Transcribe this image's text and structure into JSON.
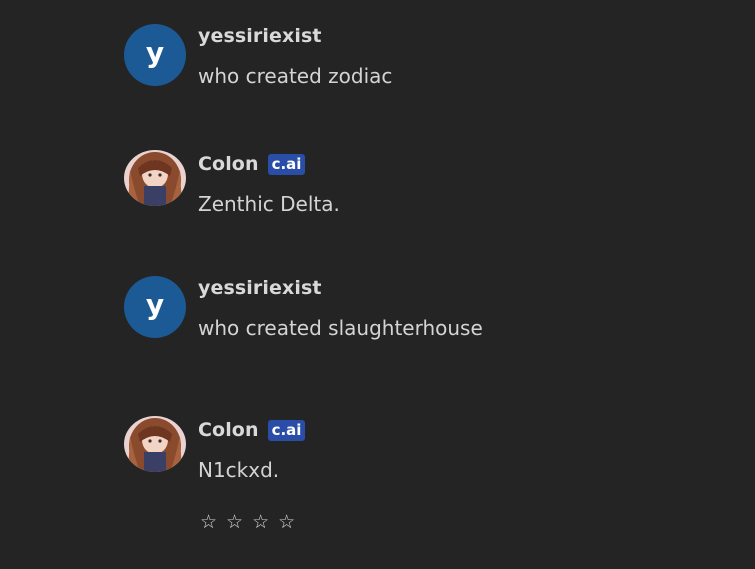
{
  "messages": [
    {
      "author": "yessiriexist",
      "avatar_letter": "y",
      "text": "who created zodiac"
    },
    {
      "author": "Colon",
      "badge": "c.ai",
      "text": "Zenthic Delta."
    },
    {
      "author": "yessiriexist",
      "avatar_letter": "y",
      "text": "who created slaughterhouse"
    },
    {
      "author": "Colon",
      "badge": "c.ai",
      "text": "N1ckxd."
    }
  ],
  "rating": {
    "stars": 4,
    "selected": 0,
    "star_glyph": "☆"
  },
  "colors": {
    "background": "#242424",
    "user_avatar": "#1c5a96",
    "badge": "#2a4ea8"
  }
}
